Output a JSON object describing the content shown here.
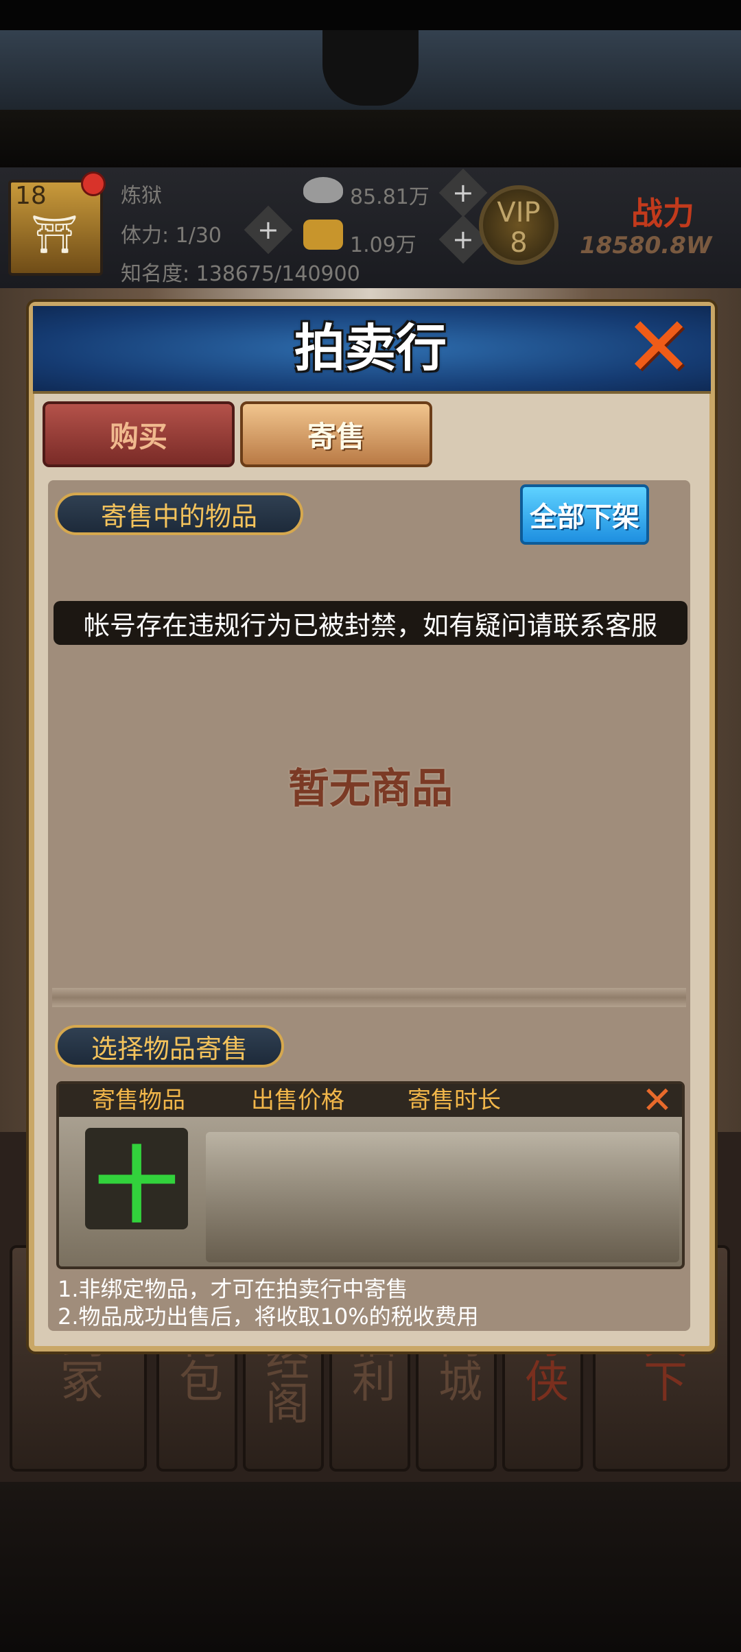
{
  "status": {
    "level": "18",
    "player_name": "炼狱",
    "stamina": "体力: 1/30",
    "fame": "知名度: 138675/140900",
    "silver": "85.81万",
    "gold": "1.09万",
    "plus": "+",
    "vip_label": "VIP",
    "vip_level": "8",
    "power_label": "战力",
    "power_value": "18580.8W"
  },
  "nav": [
    "剑冢",
    "背包",
    "藏经阁",
    "福利",
    "商城",
    "寻侠",
    "天下"
  ],
  "modal": {
    "title": "拍卖行",
    "close_glyph": "✕",
    "tabs": {
      "buy": "购买",
      "sell": "寄售"
    },
    "consign_section": "寄售中的物品",
    "delist_all": "全部下架",
    "ban_notice": "帐号存在违规行为已被封禁，如有疑问请联系客服",
    "empty_text": "暂无商品",
    "select_section": "选择物品寄售",
    "columns": [
      "寄售物品",
      "出售价格",
      "寄售时长"
    ],
    "add_glyph": "十",
    "rules": [
      "1.非绑定物品，才可在拍卖行中寄售",
      "2.物品成功出售后，将收取10%的税收费用"
    ]
  },
  "colors": {
    "accent_gold": "#f4c35c",
    "header_blue": "#1e5aa0",
    "delist_blue": "#1e8fe0",
    "add_green": "#32d23c",
    "close_orange": "#f05c18"
  }
}
